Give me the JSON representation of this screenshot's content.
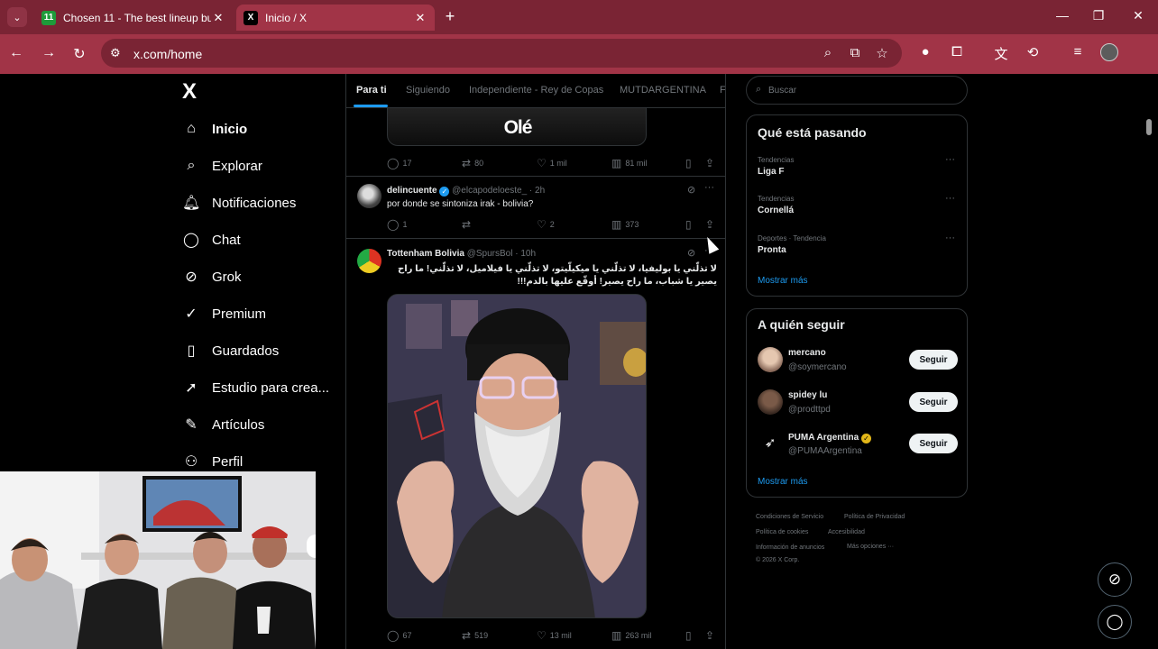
{
  "browser": {
    "tabs": [
      {
        "label": "Chosen 11 - The best lineup bu",
        "favicon": "11"
      },
      {
        "label": "Inicio / X",
        "favicon": "X"
      }
    ],
    "url": "x.com/home"
  },
  "nav": {
    "logo": "X",
    "items": [
      {
        "label": "Inicio",
        "icon": "home-icon"
      },
      {
        "label": "Explorar",
        "icon": "search-icon"
      },
      {
        "label": "Notificaciones",
        "icon": "bell-icon"
      },
      {
        "label": "Chat",
        "icon": "chat-icon"
      },
      {
        "label": "Grok",
        "icon": "grok-icon"
      },
      {
        "label": "Premium",
        "icon": "premium-icon"
      },
      {
        "label": "Guardados",
        "icon": "bookmark-icon"
      },
      {
        "label": "Estudio para crea...",
        "icon": "rocket-icon"
      },
      {
        "label": "Artículos",
        "icon": "article-icon"
      },
      {
        "label": "Perfil",
        "icon": "profile-icon"
      }
    ]
  },
  "feed": {
    "tabs": [
      "Para ti",
      "Siguiendo",
      "Independiente - Rey de Copas",
      "MUTDARGENTINA",
      "F"
    ],
    "card_text": "Olé",
    "post0_actions": {
      "replies": "17",
      "reposts": "80",
      "likes": "1 mil",
      "views": "81 mil"
    },
    "post1": {
      "name": "delincuente",
      "handle": "@elcapodeloeste_",
      "time": "2h",
      "text": "por donde se sintoniza irak - bolivia?",
      "replies": "1",
      "reposts": "",
      "likes": "2",
      "views": "373"
    },
    "post2": {
      "name": "Tottenham Bolivia",
      "handle": "@SpursBol",
      "time": "10h",
      "text": "لا تذلّني يا بوليفيا، لا تذلّني يا ميكيلّيتو، لا تذلّني يا فيلاميل، لا تذلّني! ما راح يصير يا شباب، ما راح يصير! أوقّع عليها بالدم!!!",
      "replies": "67",
      "reposts": "519",
      "likes": "13 mil",
      "views": "263 mil"
    }
  },
  "sidebar": {
    "search_placeholder": "Buscar",
    "trending": {
      "title": "Qué está pasando",
      "items": [
        {
          "meta": "Tendencias",
          "name": "Liga F"
        },
        {
          "meta": "Tendencias",
          "name": "Cornellá"
        },
        {
          "meta": "Deportes · Tendencia",
          "name": "Pronta"
        }
      ],
      "show_more": "Mostrar más"
    },
    "who_to_follow": {
      "title": "A quién seguir",
      "users": [
        {
          "name": "mercano",
          "handle": "@soymercano",
          "button": "Seguir"
        },
        {
          "name": "spidey lu",
          "handle": "@prodttpd",
          "button": "Seguir"
        },
        {
          "name": "PUMA Argentina",
          "handle": "@PUMAArgentina",
          "button": "Seguir"
        }
      ],
      "show_more": "Mostrar más"
    },
    "footer": [
      "Condiciones de Servicio",
      "Política de Privacidad",
      "Política de cookies",
      "Accesibilidad",
      "Información de anuncios",
      "Más opciones ···",
      "© 2026 X Corp."
    ]
  },
  "colors": {
    "accent": "#1d9bf0",
    "browser_frame": "#7a2434",
    "browser_toolbar": "#a13447"
  }
}
